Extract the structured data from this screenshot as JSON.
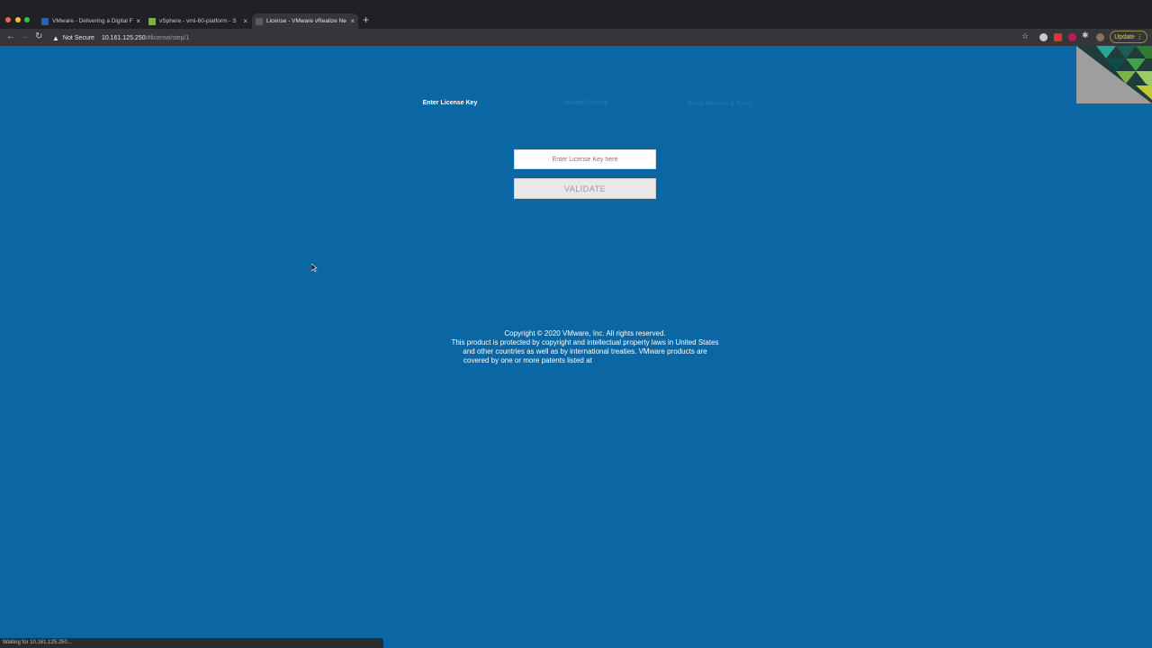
{
  "browser": {
    "tabs": [
      {
        "title": "VMware - Delivering a Digital F",
        "favicon_color": "#2f5fb3"
      },
      {
        "title": "vSphere - vrni-60-platform - S",
        "favicon_color": "#7cb342"
      },
      {
        "title": "License - VMware vRealize Ne",
        "favicon_color": "#5a5a5a"
      }
    ],
    "close_glyph": "×",
    "new_tab_glyph": "+",
    "security_label": "Not Secure",
    "url_host": "10.161.125.250",
    "url_path": "/#license/step/1",
    "update_label": "Update",
    "status_text": "Waiting for 10.161.125.250..."
  },
  "steps": {
    "step1": "Enter License Key",
    "step2": "Validate License",
    "step3": "Setup Network & Proxy"
  },
  "license_form": {
    "placeholder": "Enter License Key here",
    "validate_label": "VALIDATE"
  },
  "footer": {
    "line1": "Copyright © 2020 VMware, Inc. All rights reserved.",
    "line2": "This product is protected by copyright and intellectual property laws in United States",
    "line3": "and other countries as well as by international treaties. VMware products are",
    "line4": "covered by one or more patents listed at"
  },
  "colors": {
    "page_background": "#0a67a3",
    "browser_chrome": "#202124"
  }
}
